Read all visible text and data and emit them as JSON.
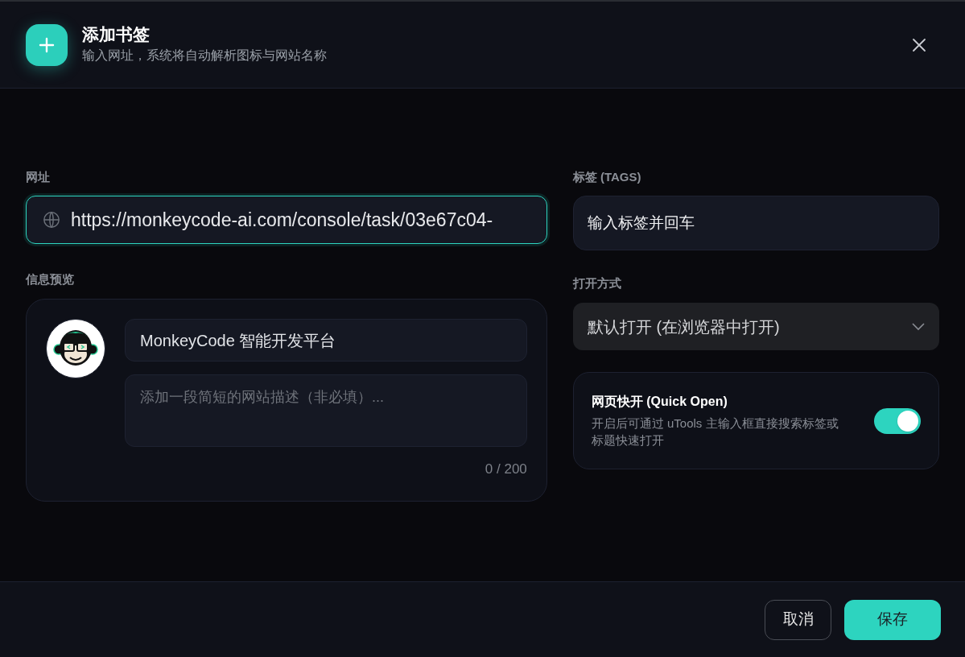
{
  "dialog": {
    "title": "添加书签",
    "subtitle": "输入网址，系统将自动解析图标与网站名称"
  },
  "url": {
    "label": "网址",
    "value": "https://monkeycode-ai.com/console/task/03e67c04-",
    "focused": true
  },
  "preview": {
    "label": "信息预览",
    "site_name": "MonkeyCode 智能开发平台",
    "description_placeholder": "添加一段简短的网站描述（非必填）...",
    "counter": "0 / 200"
  },
  "tags": {
    "label": "标签 (TAGS)",
    "placeholder": "输入标签并回车"
  },
  "open_mode": {
    "label": "打开方式",
    "value": "默认打开 (在浏览器中打开)"
  },
  "quick_open": {
    "title": "网页快开 (Quick Open)",
    "description": "开启后可通过 uTools 主输入框直接搜索标签或标题快速打开",
    "on": true
  },
  "buttons": [
    {
      "label": "取消",
      "kind": "secondary"
    },
    {
      "label": "保存",
      "kind": "primary"
    }
  ]
}
